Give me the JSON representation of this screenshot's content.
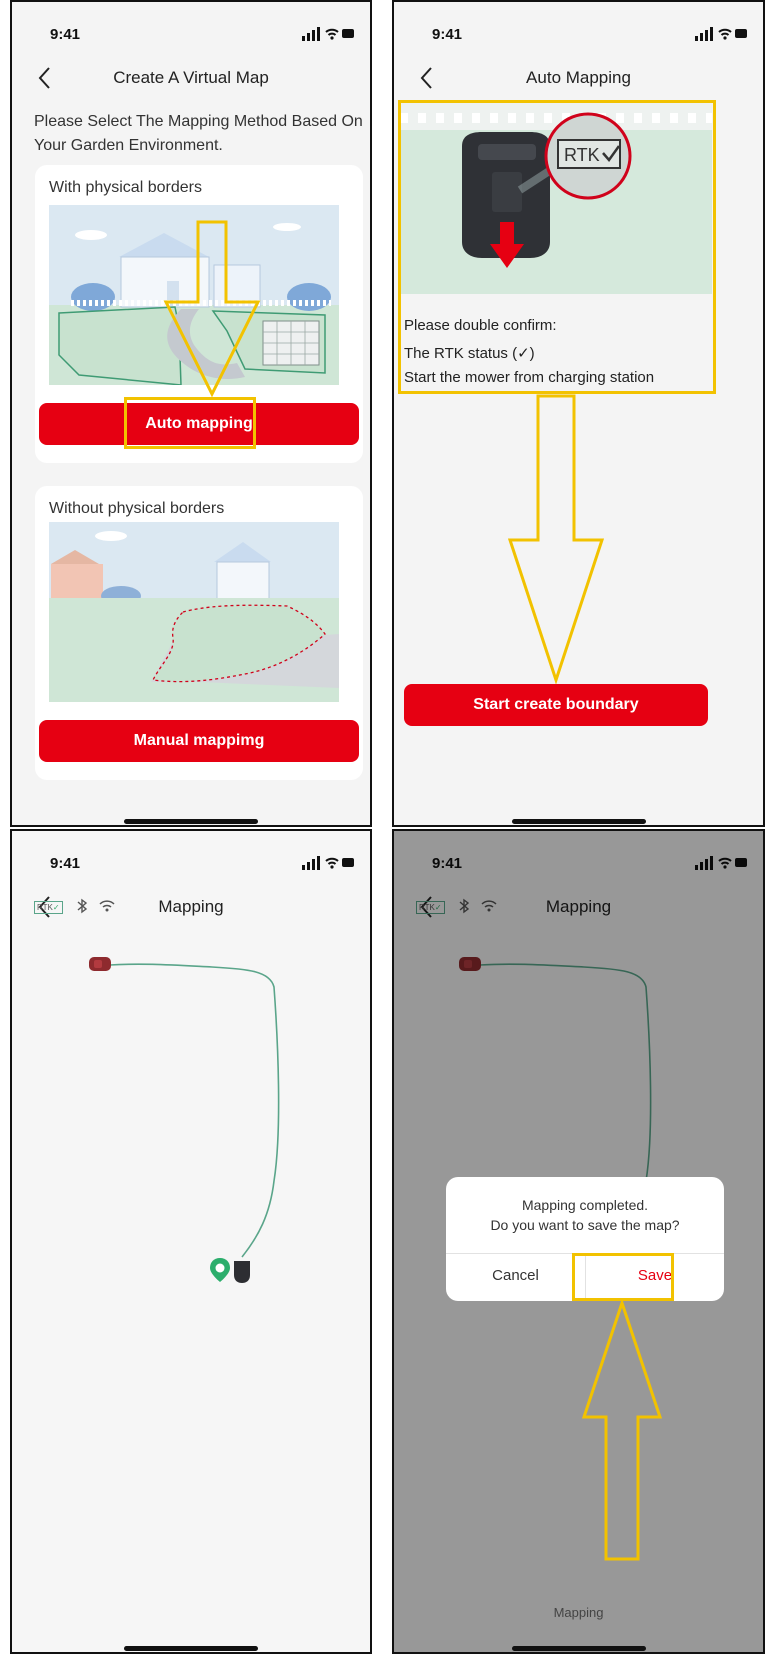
{
  "status": {
    "time": "9:41"
  },
  "screen1": {
    "title": "Create A Virtual Map",
    "intro": "Please Select The Mapping Method Based On Your Garden Environment.",
    "card1": {
      "title": "With physical borders",
      "button": "Auto mapping"
    },
    "card2": {
      "title": "Without physical borders",
      "button": "Manual mappimg"
    }
  },
  "screen2": {
    "title": "Auto Mapping",
    "badge": "RTK",
    "confirm_title": "Please double confirm:",
    "items": [
      "The RTK status (✓)",
      "Start the mower from charging station"
    ],
    "button": "Start create boundary"
  },
  "screen3": {
    "title": "Mapping",
    "rtk": "RTK"
  },
  "screen4": {
    "title": "Mapping",
    "rtk": "RTK",
    "dialog": {
      "line1": "Mapping completed.",
      "line2": "Do you want to save the map?",
      "cancel": "Cancel",
      "save": "Save"
    },
    "footer": "Mapping"
  },
  "colors": {
    "brand_red": "#e60012",
    "highlight": "#f2c200",
    "path_green": "#5aa58a"
  }
}
